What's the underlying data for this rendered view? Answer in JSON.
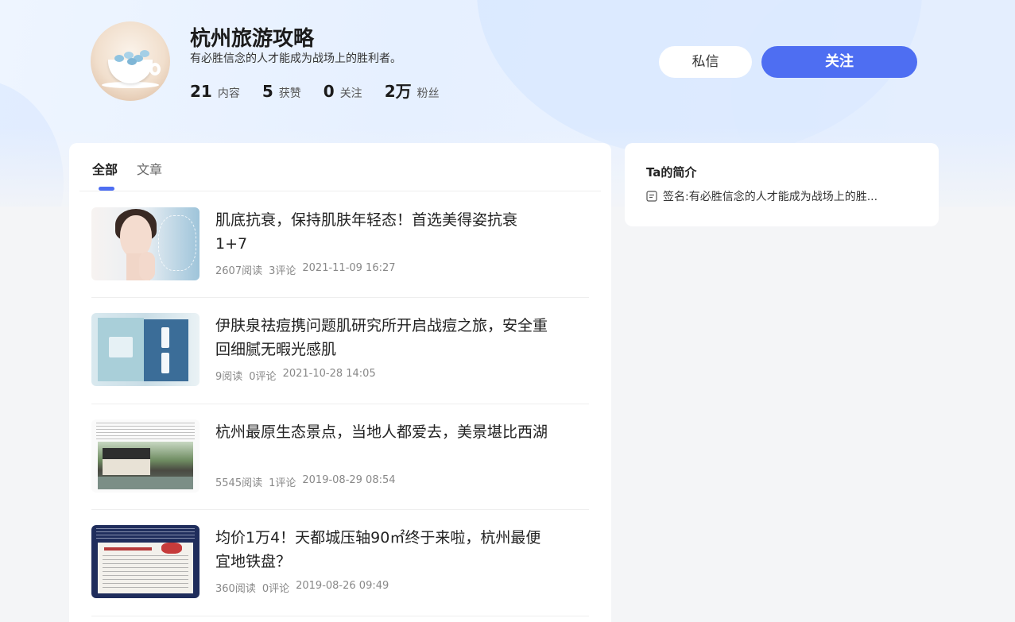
{
  "profile": {
    "name": "杭州旅游攻略",
    "signature": "有必胜信念的人才能成为战场上的胜利者。",
    "stats": [
      {
        "num": "21",
        "label": "内容"
      },
      {
        "num": "5",
        "label": "获赞"
      },
      {
        "num": "0",
        "label": "关注"
      },
      {
        "num": "2万",
        "label": "粉丝"
      }
    ]
  },
  "actions": {
    "message_label": "私信",
    "follow_label": "关注"
  },
  "tabs": [
    {
      "label": "全部",
      "active": true
    },
    {
      "label": "文章",
      "active": false
    }
  ],
  "feed": [
    {
      "title": "肌底抗衰，保持肌肤年轻态！首选美得姿抗衰1+7",
      "reads": "2607阅读",
      "comments": "3评论",
      "date": "2021-11-09 16:27"
    },
    {
      "title": "伊肤泉祛痘携问题肌研究所开启战痘之旅，安全重回细腻无暇光感肌",
      "reads": "9阅读",
      "comments": "0评论",
      "date": "2021-10-28 14:05"
    },
    {
      "title": "杭州最原生态景点，当地人都爱去，美景堪比西湖",
      "reads": "5545阅读",
      "comments": "1评论",
      "date": "2019-08-29 08:54"
    },
    {
      "title": "均价1万4！天都城压轴90㎡终于来啦，杭州最便宜地铁盘？",
      "reads": "360阅读",
      "comments": "0评论",
      "date": "2019-08-26 09:49"
    }
  ],
  "intro": {
    "title": "Ta的简介",
    "signature_label": "签名: ",
    "signature_text": "有必胜信念的人才能成为战场上的胜..."
  },
  "colors": {
    "accent": "#4e6ef2",
    "background": "#f4f5f7"
  }
}
